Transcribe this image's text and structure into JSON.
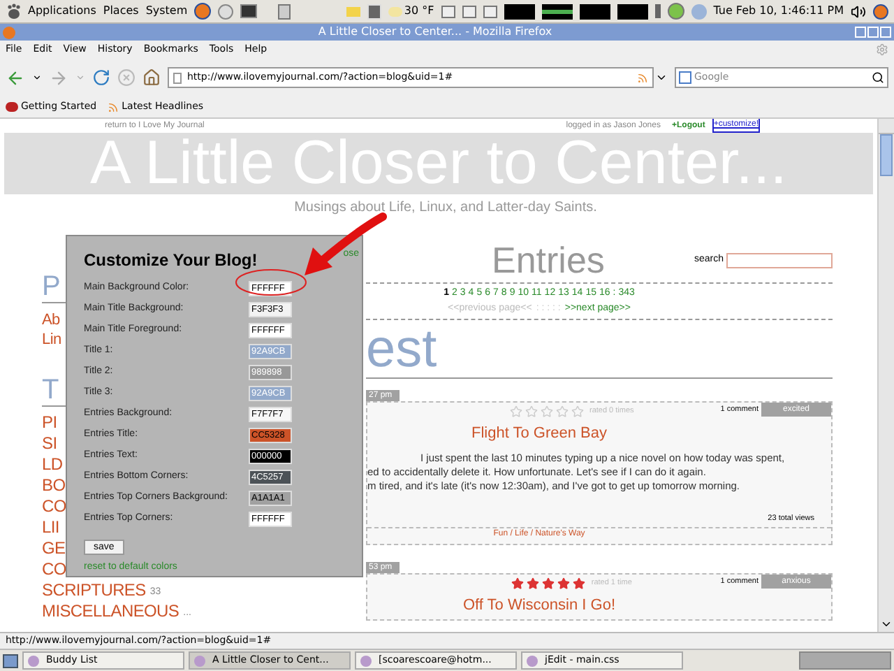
{
  "top_panel": {
    "menus": [
      "Applications",
      "Places",
      "System"
    ],
    "weather": "30 °F",
    "clock": "Tue Feb 10,  1:46:11 PM"
  },
  "window": {
    "title": "A Little Closer to Center... - Mozilla Firefox"
  },
  "menu_bar": [
    "File",
    "Edit",
    "View",
    "History",
    "Bookmarks",
    "Tools",
    "Help"
  ],
  "address_bar": {
    "value": "http://www.ilovemyjournal.com/?action=blog&uid=1#"
  },
  "search_box": {
    "placeholder": "Google"
  },
  "bookmarks": [
    "Getting Started",
    "Latest Headlines"
  ],
  "page": {
    "return_link": "return to I Love My Journal",
    "login_text": "logged in as Jason Jones",
    "logout_link": "+Logout",
    "customize_link": "+customize!",
    "blog_title": "A Little Closer to Center...",
    "tagline": "Musings about Life, Linux, and Latter-day Saints."
  },
  "sidebar": {
    "sections": [
      {
        "heading": "P",
        "links": [
          "Ab",
          "Lin"
        ]
      },
      {
        "heading": "T"
      }
    ],
    "categories": [
      {
        "name": "PI"
      },
      {
        "name": "SI"
      },
      {
        "name": "LD"
      },
      {
        "name": "BO"
      },
      {
        "name": "CO"
      },
      {
        "name": "LII"
      },
      {
        "name": "GE"
      },
      {
        "name": "CO"
      },
      {
        "name": "SCRIPTURES",
        "count": "33"
      },
      {
        "name": "MISCELLANEOUS",
        "count": "..."
      }
    ]
  },
  "customize_dialog": {
    "title": "Customize Your Blog!",
    "close_link": "ose",
    "fields": [
      {
        "label": "Main Background Color:",
        "value": "FFFFFF"
      },
      {
        "label": "Main Title Background:",
        "value": "F3F3F3"
      },
      {
        "label": "Main Title Foreground:",
        "value": "FFFFFF"
      },
      {
        "label": "Title 1:",
        "value": "92A9CB"
      },
      {
        "label": "Title 2:",
        "value": "989898"
      },
      {
        "label": "Title 3:",
        "value": "92A9CB"
      },
      {
        "label": "Entries Background:",
        "value": "F7F7F7"
      },
      {
        "label": "Entries Title:",
        "value": "CC5328"
      },
      {
        "label": "Entries Text:",
        "value": "000000"
      },
      {
        "label": "Entries Bottom Corners:",
        "value": "4C5257"
      },
      {
        "label": "Entries Top Corners Background:",
        "value": "A1A1A1"
      },
      {
        "label": "Entries Top Corners:",
        "value": "FFFFFF"
      }
    ],
    "save_button": "save",
    "reset_link": "reset to default colors"
  },
  "entries": {
    "heading": "Entries",
    "search_label": "search",
    "pages": [
      {
        "label": "1",
        "selected": true
      },
      {
        "label": "2",
        "selected": false
      },
      {
        "label": "3",
        "selected": false
      },
      {
        "label": "4",
        "selected": false
      },
      {
        "label": "5",
        "selected": false
      },
      {
        "label": "6",
        "selected": false
      },
      {
        "label": "7",
        "selected": false
      },
      {
        "label": "8",
        "selected": false
      },
      {
        "label": "9",
        "selected": false
      },
      {
        "label": "10",
        "selected": false
      },
      {
        "label": "11",
        "selected": false
      },
      {
        "label": "12",
        "selected": false
      },
      {
        "label": "13",
        "selected": false
      },
      {
        "label": "14",
        "selected": false
      },
      {
        "label": "15",
        "selected": false
      },
      {
        "label": "16",
        "selected": false
      },
      {
        "label": ":",
        "selected": false
      },
      {
        "label": "343",
        "selected": false
      }
    ],
    "previous_page": {
      "label": "<<previous page<<",
      "disabled": true
    },
    "page_dots": ": : : : :",
    "next_page": {
      "label": ">>next page>>",
      "disabled": false
    },
    "latest_heading": "est",
    "posts": [
      {
        "time": "27 pm",
        "stars": 0,
        "rating": "rated 0 times",
        "comments": "1 comment",
        "mood": "excited",
        "title": "Flight To Green Bay",
        "body": [
          "I just spent the last 10 minutes typing up a nice novel on how today was spent,",
          "ed to accidentally delete it.  How unfortunate.  Let's see if I can do it again.",
          "m tired, and it's late (it's now 12:30am), and I've got to get up tomorrow morning."
        ],
        "views": "23 total views",
        "tags": "Fun / Life / Nature's Way"
      },
      {
        "time": "53 pm",
        "stars": 5,
        "rating": "rated 1 time",
        "comments": "1 comment",
        "mood": "anxious",
        "title": "Off To Wisconsin I Go!"
      }
    ]
  },
  "status_bar": {
    "text": "http://www.ilovemyjournal.com/?action=blog&uid=1#"
  },
  "taskbar": [
    {
      "label": "Buddy List",
      "selected": false
    },
    {
      "label": "A Little Closer to Cent...",
      "selected": true
    },
    {
      "label": "[scoarescoare@hotm...",
      "selected": false
    },
    {
      "label": "jEdit - main.css",
      "selected": false
    }
  ]
}
